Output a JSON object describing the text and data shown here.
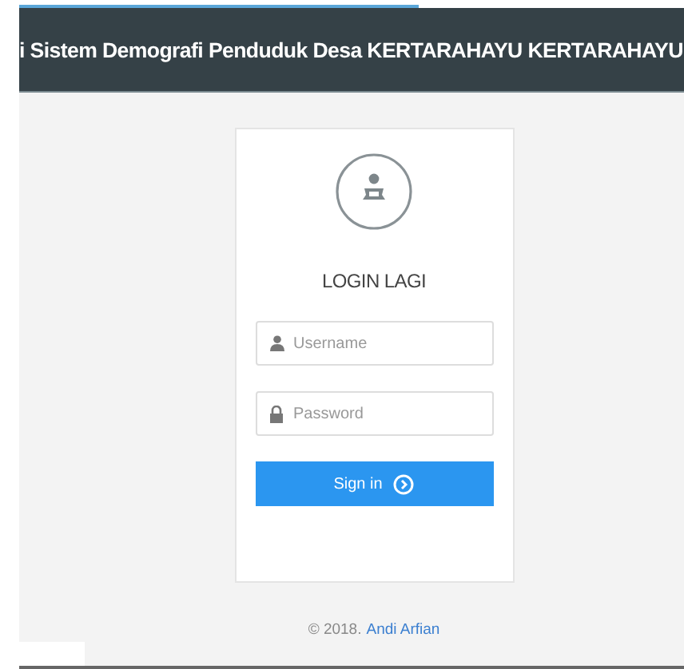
{
  "loading_bar": {
    "level": 0.6
  },
  "header": {
    "title": "i Sistem Demografi Penduduk Desa KERTARAHAYU KERTARAHAYU"
  },
  "login": {
    "heading": "LOGIN LAGI",
    "fields": [
      {
        "kind": "user",
        "placeholder": "Username"
      },
      {
        "kind": "lock",
        "placeholder": "Password"
      }
    ],
    "button": "Sign in"
  },
  "footer": {
    "text": "© 2018.",
    "link": "Andi Arfian"
  }
}
